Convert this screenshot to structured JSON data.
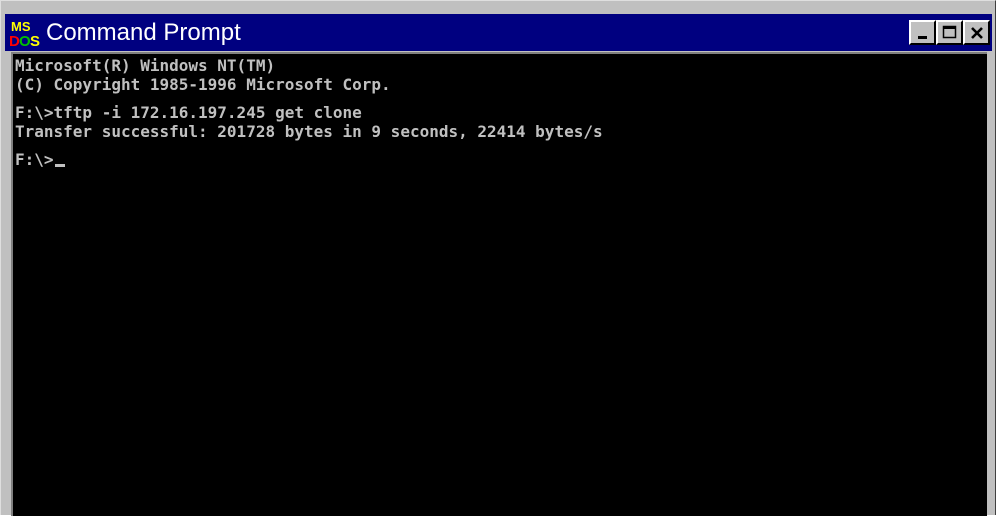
{
  "window": {
    "title": "Command Prompt",
    "icon": "ms-dos-icon",
    "icon_text": "MS DOS",
    "controls": {
      "minimize": "minimize-icon",
      "maximize": "maximize-icon",
      "close": "close-icon"
    }
  },
  "console": {
    "lines": [
      "Microsoft(R) Windows NT(TM)",
      "(C) Copyright 1985-1996 Microsoft Corp.",
      "F:\\>tftp -i 172.16.197.245 get clone",
      "Transfer successful: 201728 bytes in 9 seconds, 22414 bytes/s"
    ],
    "prompt": "F:\\>"
  },
  "colors": {
    "titlebar": "#000080",
    "title_text": "#ffffff",
    "console_bg": "#000000",
    "console_text": "#c0c0c0",
    "frame": "#c0c0c0"
  }
}
